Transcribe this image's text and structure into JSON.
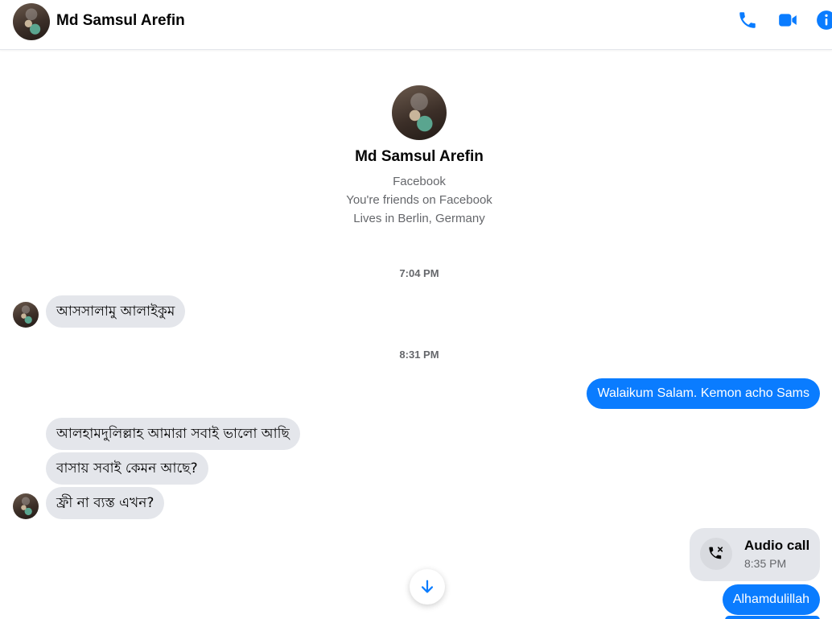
{
  "header": {
    "contact_name": "Md Samsul Arefin",
    "icons": [
      "phone-icon",
      "video-camera-icon",
      "info-icon"
    ]
  },
  "colors": {
    "accent": "#0a7cff",
    "incoming_bubble": "#e4e6eb",
    "muted_text": "#65676b"
  },
  "profile": {
    "name": "Md Samsul Arefin",
    "line1": "Facebook",
    "line2": "You're friends on Facebook",
    "line3": "Lives in Berlin, Germany"
  },
  "messages": {
    "ts1": "7:04 PM",
    "m1": "আসসালামু আলাইকুম",
    "ts2": "8:31 PM",
    "m2": "Walaikum Salam. Kemon acho Sams",
    "m3": "আলহামদুলিল্লাহ আমারা সবাই ভালো আছি",
    "m4": "বাসায় সবাই কেমন আছে?",
    "m5": "ফ্রী না ব্যস্ত এখন?",
    "call_title": "Audio call",
    "call_time": "8:35 PM",
    "m6": "Alhamdulillah"
  }
}
